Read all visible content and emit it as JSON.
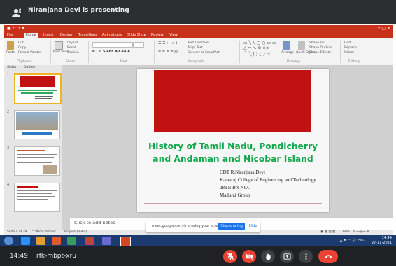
{
  "meet": {
    "presenting_text": "Niranjana Devi is presenting",
    "time": "14:49",
    "meeting_code": "rfk-mbpt-xru",
    "colors": {
      "danger": "#ea4335",
      "bar": "#202124"
    }
  },
  "ppt": {
    "tabs": [
      "File",
      "Home",
      "Insert",
      "Design",
      "Transitions",
      "Animations",
      "Slide Show",
      "Review",
      "View"
    ],
    "active_tab": "Home",
    "ribbon": {
      "clipboard": {
        "cut": "Cut",
        "copy": "Copy",
        "paste": "Paste",
        "format_painter": "Format Painter",
        "label": "Clipboard"
      },
      "slides": {
        "new_slide": "New Slide",
        "layout": "Layout",
        "reset": "Reset",
        "section": "Section",
        "label": "Slides"
      },
      "font_label": "Font",
      "paragraph": {
        "text_direction": "Text Direction",
        "align_text": "Align Text",
        "convert_smartart": "Convert to SmartArt",
        "label": "Paragraph"
      },
      "drawing": {
        "arrange": "Arrange",
        "quick_styles": "Quick Styles",
        "shape_fill": "Shape Fill",
        "shape_outline": "Shape Outline",
        "shape_effects": "Shape Effects",
        "label": "Drawing"
      },
      "editing": {
        "find": "Find",
        "replace": "Replace",
        "select": "Select",
        "label": "Editing"
      }
    },
    "panel_tabs": [
      "Slides",
      "Outline"
    ],
    "thumb_numbers": [
      "1",
      "2",
      "3",
      "4"
    ],
    "slide": {
      "title": "History of Tamil Nadu, Pondicherry and Andaman and Nicobar Island",
      "lines": [
        "CDT R.Niranjana Devi",
        "Kamaraj College of Engineering and Technology",
        "28TN BN NCC",
        "Madurai Group"
      ]
    },
    "notes_placeholder": "Click to add notes",
    "status": {
      "slide_count": "Slide 1 of 29",
      "theme": "\"Office Theme\"",
      "language": "English (India)",
      "zoom": "69%"
    }
  },
  "share_notice": {
    "text": "meet.google.com is sharing your screen.",
    "stop_label": "Stop sharing",
    "hide_label": "Hide"
  },
  "taskbar": {
    "time": "14:49",
    "date": "27-11-2021",
    "lang": "ENG"
  }
}
